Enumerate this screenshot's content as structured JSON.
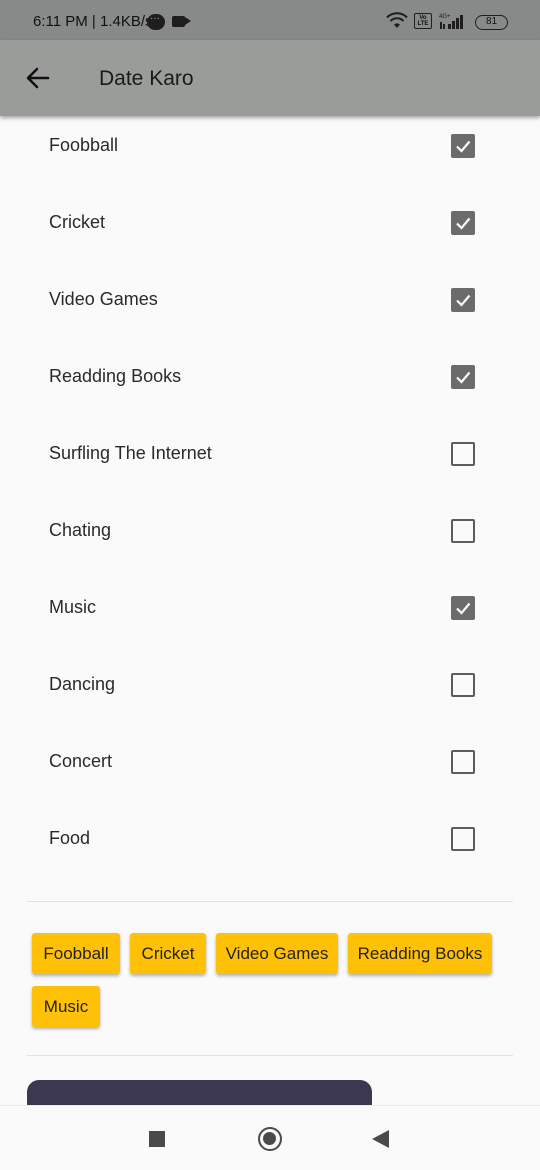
{
  "status_bar": {
    "time": "6:11 PM",
    "network_speed": "1.4KB/s",
    "battery": "81",
    "volte_label": "Vo LTE",
    "network_type": "4G+"
  },
  "app_bar": {
    "title": "Date Karo",
    "back_icon": "arrow-left-icon"
  },
  "interests": [
    {
      "label": "Foobball",
      "checked": true
    },
    {
      "label": "Cricket",
      "checked": true
    },
    {
      "label": "Video Games",
      "checked": true
    },
    {
      "label": "Readding Books",
      "checked": true
    },
    {
      "label": "Surfling The Internet",
      "checked": false
    },
    {
      "label": "Chating",
      "checked": false
    },
    {
      "label": "Music",
      "checked": true
    },
    {
      "label": "Dancing",
      "checked": false
    },
    {
      "label": "Concert",
      "checked": false
    },
    {
      "label": "Food",
      "checked": false
    }
  ],
  "selected_chips": [
    "Foobball",
    "Cricket",
    "Video Games",
    "Readding Books",
    "Music"
  ],
  "colors": {
    "app_bar": "#9a9c9a",
    "chip": "#ffc107",
    "checkbox_checked": "#6b6b6b",
    "primary_button": "#3d3852"
  },
  "nav_icons": [
    "recents-square-icon",
    "home-circle-icon",
    "back-triangle-icon"
  ]
}
